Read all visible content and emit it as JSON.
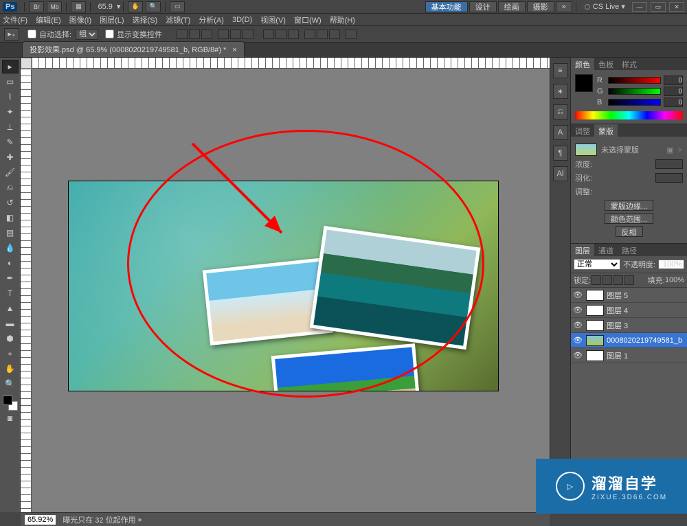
{
  "app": {
    "logo": "Ps",
    "zoom_display": "65.9"
  },
  "workspace_switcher": {
    "items": [
      "基本功能",
      "设计",
      "绘画",
      "摄影"
    ],
    "active_index": 0
  },
  "cslive": {
    "label": "CS Live"
  },
  "menu": [
    "文件(F)",
    "编辑(E)",
    "图像(I)",
    "图层(L)",
    "选择(S)",
    "滤镜(T)",
    "分析(A)",
    "3D(D)",
    "视图(V)",
    "窗口(W)",
    "帮助(H)"
  ],
  "options_bar": {
    "auto_select_label": "自动选择:",
    "group_label": "组",
    "show_transform_label": "显示变换控件"
  },
  "document_tab": {
    "title": "投影效果.psd @ 65.9% (0008020219749581_b, RGB/8#) *"
  },
  "color_panel": {
    "tabs": [
      "颜色",
      "色板",
      "样式"
    ],
    "r_label": "R",
    "r_value": "0",
    "g_label": "G",
    "g_value": "0",
    "b_label": "B",
    "b_value": "0"
  },
  "mask_panel": {
    "tabs": [
      "调整",
      "蒙版"
    ],
    "no_sel": "未选择蒙版",
    "density_label": "浓度:",
    "feather_label": "羽化:",
    "refine_label": "调整:",
    "btn_edge": "蒙版边缘...",
    "btn_range": "颜色范围...",
    "btn_invert": "反相"
  },
  "layers_panel": {
    "tabs": [
      "图层",
      "通道",
      "路径"
    ],
    "blend": "正常",
    "opacity_label": "不透明度:",
    "opacity_value": "100%",
    "lock_label": "锁定:",
    "fill_label": "填充:",
    "fill_value": "100%",
    "layers": [
      {
        "name": "图层 5",
        "selected": false,
        "bg": false
      },
      {
        "name": "图层 4",
        "selected": false,
        "bg": false
      },
      {
        "name": "图层 3",
        "selected": false,
        "bg": false
      },
      {
        "name": "0008020219749581_b",
        "selected": true,
        "bg": true
      },
      {
        "name": "图层 1",
        "selected": false,
        "bg": false
      }
    ]
  },
  "status_bar": {
    "zoom": "65.92%",
    "info": "曝光只在 32 位起作用"
  },
  "watermark": {
    "title": "溜溜自学",
    "url": "ZIXUE.3D66.COM"
  }
}
